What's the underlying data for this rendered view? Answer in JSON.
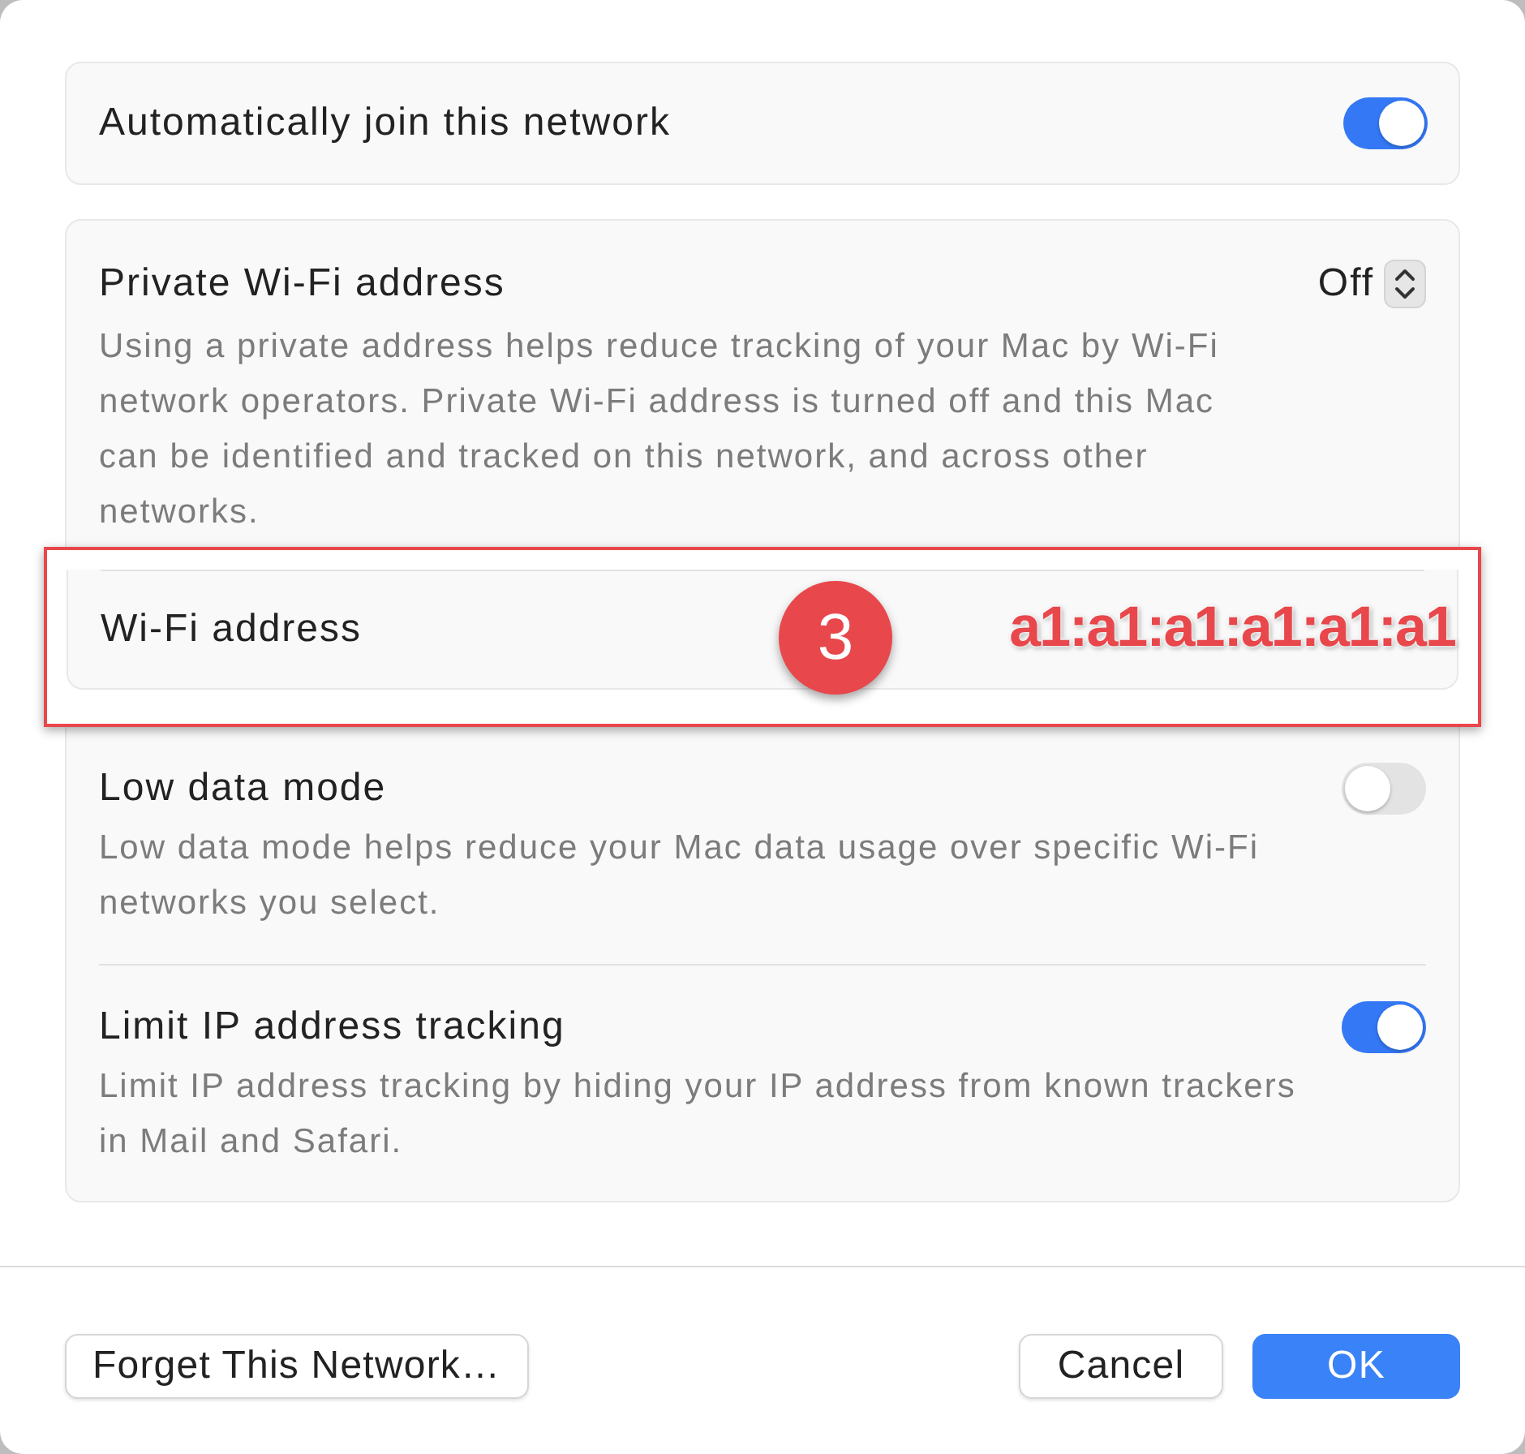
{
  "auto_join": {
    "label": "Automatically join this network",
    "on": true
  },
  "private_address": {
    "label": "Private Wi-Fi address",
    "value": "Off",
    "description": "Using a private address helps reduce tracking of your Mac by Wi-Fi network operators. Private Wi-Fi address is turned off and this Mac can be identified and tracked on this network, and across other networks."
  },
  "wifi_address": {
    "label": "Wi-Fi address"
  },
  "annotation": {
    "badge": "3",
    "text": "a1:a1:a1:a1:a1:a1"
  },
  "settings": [
    {
      "label": "Low data mode",
      "on": false,
      "description": "Low data mode helps reduce your Mac data usage over specific Wi-Fi networks you select."
    },
    {
      "label": "Limit IP address tracking",
      "on": true,
      "description": "Limit IP address tracking by hiding your IP address from known trackers in Mail and Safari."
    }
  ],
  "buttons": [
    {
      "label": "Forget This Network…",
      "kind": "secondary"
    },
    {
      "label": "Cancel",
      "kind": "secondary"
    },
    {
      "label": "OK",
      "kind": "primary"
    }
  ]
}
